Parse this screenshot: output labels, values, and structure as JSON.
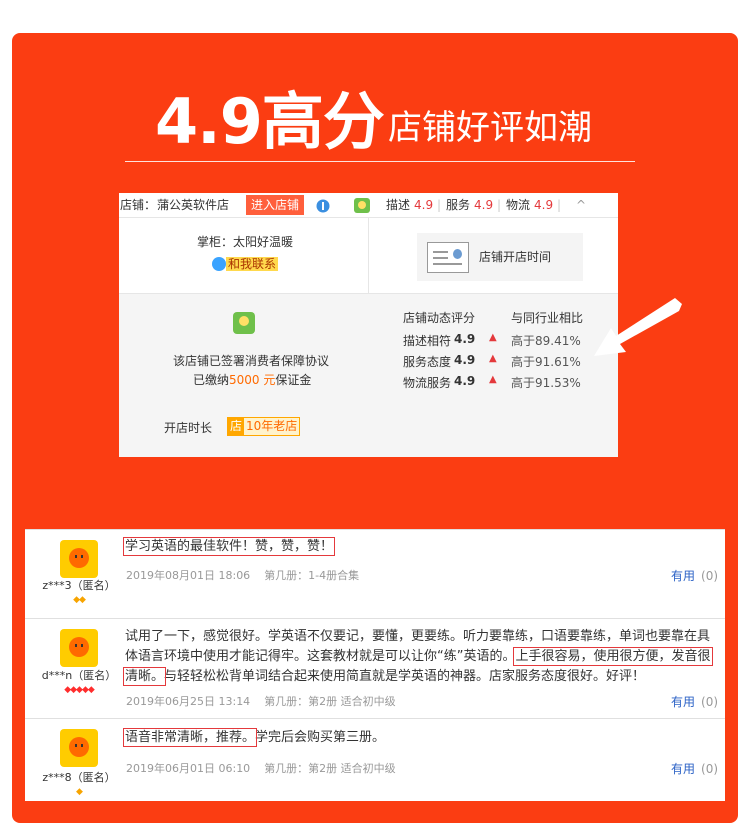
{
  "banner": {
    "score": "4.9高分",
    "slogan": "店铺好评如潮"
  },
  "shop": {
    "name_label": "店铺：",
    "name": "蒲公英软件店",
    "enter_button": "进入店铺",
    "ratings_bar": {
      "desc_label": "描述",
      "desc": "4.9",
      "service_label": "服务",
      "service": "4.9",
      "logistics_label": "物流",
      "logistics": "4.9",
      "caret": "^"
    },
    "keeper": "掌柜：太阳好温暖",
    "contact": "和我联系",
    "open_time_card": "店铺开店时间",
    "guarantee_line1": "该店铺已签署消费者保障协议",
    "deposit_prefix": "已缴纳",
    "deposit_amount": "5000 元",
    "deposit_suffix": "保证金",
    "dynamic_title": "店铺动态评分",
    "compare_title": "与同行业相比",
    "scores": [
      {
        "label": "描述相符",
        "value": "4.9",
        "compare": "高于89.41%"
      },
      {
        "label": "服务态度",
        "value": "4.9",
        "compare": "高于91.61%"
      },
      {
        "label": "物流服务",
        "value": "4.9",
        "compare": "高于91.53%"
      }
    ],
    "open_duration_label": "开店时长",
    "old_shop_icon": "店",
    "old_shop_text": "10年老店",
    "colors": {
      "accent": "#fb3d12",
      "rating": "#e4393c"
    }
  },
  "reviews": [
    {
      "user": "z***3（匿名）",
      "level_icon": "gold-diamond",
      "level_glyphs": "◆◆",
      "text_highlight": "学习英语的最佳软件！赞，赞，赞！",
      "text_rest": "",
      "date": "2019年08月01日 18:06",
      "spec": "第几册：1-4册合集",
      "useful_label": "有用",
      "useful_count": "(0)"
    },
    {
      "user": "d***n（匿名）",
      "level_icon": "red-diamond",
      "level_glyphs": "◆◆◆◆◆",
      "text_part1": "试用了一下，感觉很好。学英语不仅要记，要懂，更要练。听力要靠练，口语要靠练，单词也要靠在具体语言环境中使用才能记得牢。这套教材就是可以让你“练”英语的。",
      "text_highlight": "上手很容易，使用很方便，发音很清晰。",
      "text_part2": "与轻轻松松背单词结合起来使用简直就是学英语的神器。店家服务态度很好。好评！",
      "date": "2019年06月25日 13:14",
      "spec": "第几册：第2册 适合初中级",
      "useful_label": "有用",
      "useful_count": "(0)"
    },
    {
      "user": "z***8（匿名）",
      "level_icon": "gold-diamond",
      "level_glyphs": "◆",
      "text_highlight": "语音非常清晰，推荐。",
      "text_rest": "学完后会购买第三册。",
      "date": "2019年06月01日 06:10",
      "spec": "第几册：第2册 适合初中级",
      "useful_label": "有用",
      "useful_count": "(0)"
    }
  ]
}
